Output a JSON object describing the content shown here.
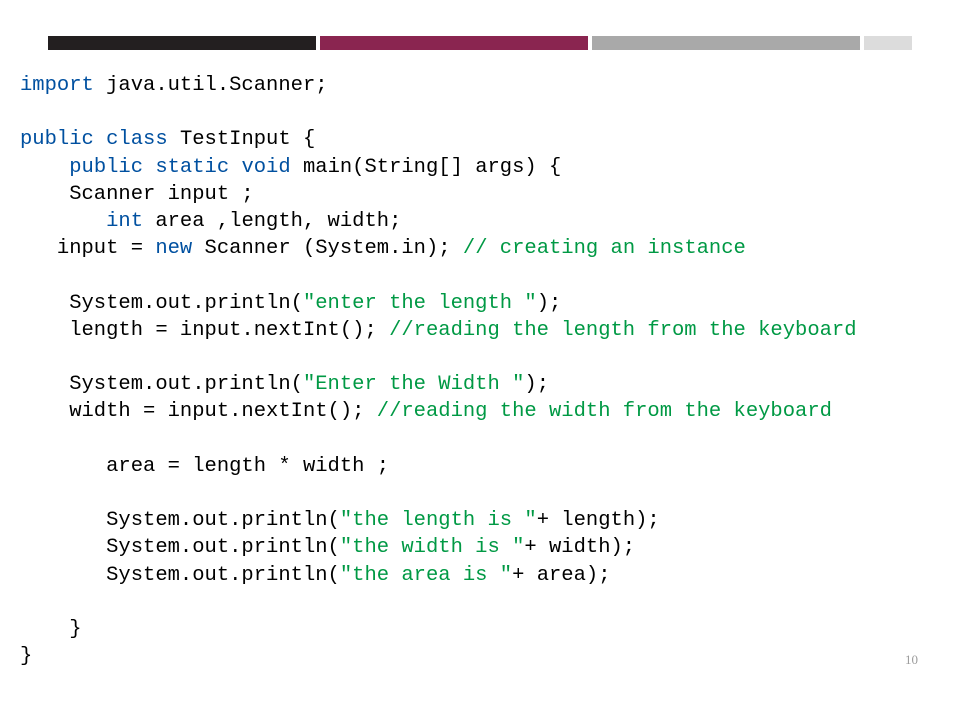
{
  "decor": {
    "colors": [
      "#231f20",
      "#8a2550",
      "#a9a9a9",
      "#dcdcdc"
    ]
  },
  "page_number": "10",
  "code": {
    "l1_import": "import",
    "l1_rest": " java.util.Scanner;",
    "l3_pc": "public class ",
    "l3_name": "TestInput {",
    "l4_indent": "    ",
    "l4_psv": "public static void ",
    "l4_sig": "main(String[] args) {",
    "l5": "    Scanner input ;",
    "l6_a": "       ",
    "l6_int": "int",
    "l6_b": " area ,length, width;",
    "l7_a": "   input = ",
    "l7_new": "new",
    "l7_b": " Scanner (System.in); ",
    "l7_c": "// creating an instance",
    "l9_a": "    System.out.println(",
    "l9_s": "\"enter the length \"",
    "l9_b": ");",
    "l10_a": "    length = input.nextInt(); ",
    "l10_c": "//reading the length from the keyboard",
    "l12_a": "    System.out.println(",
    "l12_s": "\"Enter the Width \"",
    "l12_b": ");",
    "l13_a": "    width = input.nextInt(); ",
    "l13_c": "//reading the width from the keyboard",
    "l15": "       area = length * width ;",
    "l17_a": "       System.out.println(",
    "l17_s": "\"the length is \"",
    "l17_b": "+ length);",
    "l18_a": "       System.out.println(",
    "l18_s": "\"the width is \"",
    "l18_b": "+ width);",
    "l19_a": "       System.out.println(",
    "l19_s": "\"the area is \"",
    "l19_b": "+ area);",
    "l21": "    }",
    "l22": "}"
  }
}
